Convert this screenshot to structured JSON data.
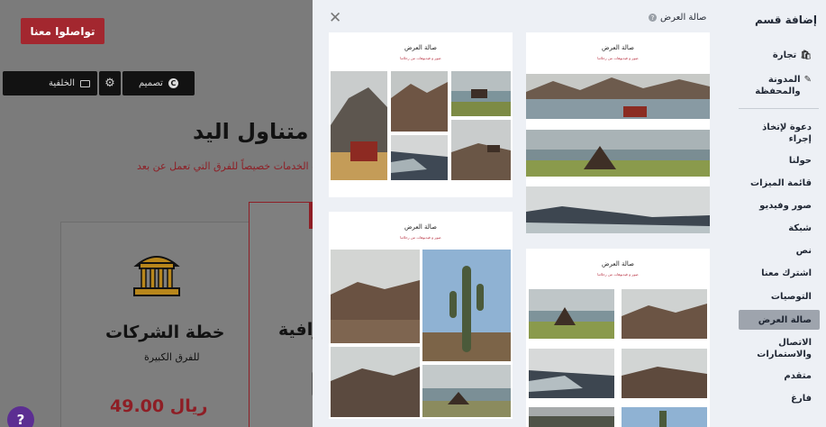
{
  "background": {
    "cta_label": "تواصلوا معنا",
    "toolbar": {
      "design_label": "تصميم",
      "design_badge": "C",
      "background_label": "الخلفية"
    },
    "heading": "ي متناول اليد!",
    "subheading": "هذه الخدمات خصيصاً للفرق التي تعمل عن بعد.",
    "plan_name": "خطة الشركات",
    "plan_sub": "للفرق الكبيرة",
    "plan_price": "49.00 ريال",
    "partial_plan": "رافية",
    "help_label": "?"
  },
  "panel": {
    "sidebar": {
      "title": "إضافة قسم",
      "items": [
        {
          "label": "تجارة",
          "icon": "bag-icon"
        },
        {
          "label": "المدونة والمحفظة",
          "icon": "edit-icon"
        },
        {
          "label": "دعوة لإتخاذ إجراء",
          "icon": ""
        },
        {
          "label": "حولنا",
          "icon": ""
        },
        {
          "label": "قائمة الميزات",
          "icon": ""
        },
        {
          "label": "صور وفيديو",
          "icon": ""
        },
        {
          "label": "شبكة",
          "icon": ""
        },
        {
          "label": "نص",
          "icon": ""
        },
        {
          "label": "اشترك معنا",
          "icon": ""
        },
        {
          "label": "التوصيات",
          "icon": ""
        },
        {
          "label": "صالة العرض",
          "icon": "",
          "active": true
        },
        {
          "label": "الاتصال والاستمارات",
          "icon": ""
        },
        {
          "label": "متقدم",
          "icon": ""
        },
        {
          "label": "فارغ",
          "icon": ""
        }
      ]
    },
    "gallery_title": "صالة العرض",
    "gallery_help": "?",
    "close_icon": "close-icon",
    "templates": [
      {
        "title": "صالة العرض",
        "subtitle": "صور و فيديوهات من رحلاتنا"
      },
      {
        "title": "صالة العرض",
        "subtitle": "صور و فيديوهات من رحلاتنا"
      },
      {
        "title": "صالة العرض",
        "subtitle": "صور و فيديوهات من رحلاتنا"
      },
      {
        "title": "صالة العرض",
        "subtitle": "صور و فيديوهات من رحلاتنا"
      }
    ]
  },
  "colors": {
    "accent": "#a3272f",
    "panel_bg": "#edf0f5",
    "active_item": "#9ea4ad",
    "help_button": "#5c2e92"
  }
}
